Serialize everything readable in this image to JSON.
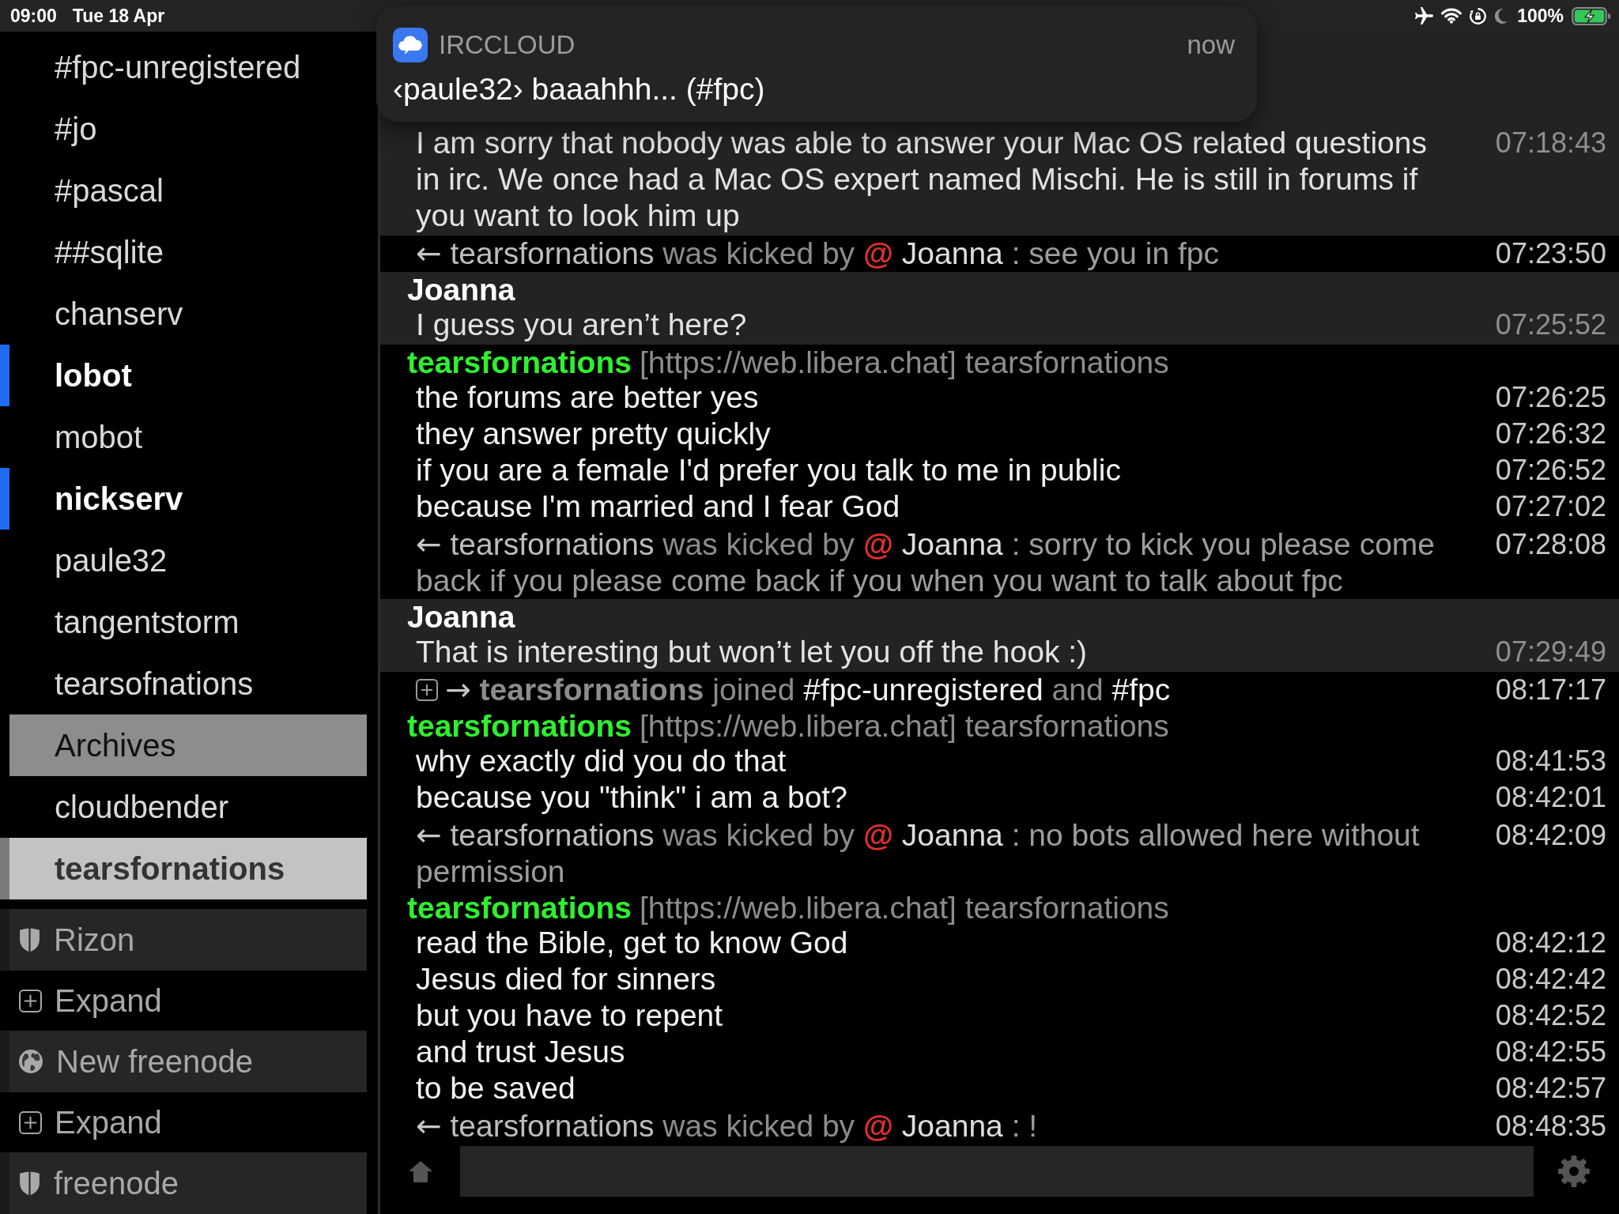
{
  "status_bar": {
    "time": "09:00",
    "date": "Tue 18 Apr",
    "battery": "100%"
  },
  "notification": {
    "app": "IRCCLOUD",
    "time": "now",
    "message": "‹paule32› baaahhh... (#fpc)"
  },
  "sidebar": {
    "items": [
      {
        "kind": "channel",
        "label": "#fpc-unregistered",
        "selected": false,
        "unread": false
      },
      {
        "kind": "channel",
        "label": "#jo",
        "selected": false,
        "unread": false
      },
      {
        "kind": "channel",
        "label": "#pascal",
        "selected": false,
        "unread": false
      },
      {
        "kind": "channel",
        "label": "##sqlite",
        "selected": false,
        "unread": false
      },
      {
        "kind": "channel",
        "label": "chanserv",
        "selected": false,
        "unread": false
      },
      {
        "kind": "channel",
        "label": "lobot",
        "selected": false,
        "unread": true
      },
      {
        "kind": "channel",
        "label": "mobot",
        "selected": false,
        "unread": false
      },
      {
        "kind": "channel",
        "label": "nickserv",
        "selected": false,
        "unread": true
      },
      {
        "kind": "channel",
        "label": "paule32",
        "selected": false,
        "unread": false
      },
      {
        "kind": "channel",
        "label": "tangentstorm",
        "selected": false,
        "unread": false
      },
      {
        "kind": "channel",
        "label": "tearsofnations",
        "selected": false,
        "unread": false
      },
      {
        "kind": "archives",
        "label": "Archives",
        "selected": false,
        "unread": false
      },
      {
        "kind": "channel",
        "label": "cloudbender",
        "selected": false,
        "unread": false
      },
      {
        "kind": "channel",
        "label": "tearsfornations",
        "selected": true,
        "unread": false
      },
      {
        "kind": "network",
        "label": "Rizon",
        "secure": true,
        "selected": false,
        "unread": false
      },
      {
        "kind": "expand",
        "label": "Expand",
        "selected": false,
        "unread": false
      },
      {
        "kind": "network",
        "label": "New freenode",
        "secure": false,
        "selected": false,
        "unread": false
      },
      {
        "kind": "expand",
        "label": "Expand",
        "selected": false,
        "unread": false
      },
      {
        "kind": "network",
        "label": "freenode",
        "secure": true,
        "selected": false,
        "unread": false
      }
    ]
  },
  "chat": {
    "entries": [
      {
        "kind": "message",
        "self": true,
        "lines": [
          {
            "text": "I am sorry that nobody was able to answer your Mac OS related questions in irc. We once had a Mac OS expert named Mischi. He is still in forums if you want to look him up",
            "time": "07:18:43"
          }
        ]
      },
      {
        "kind": "kick",
        "arrow": "←",
        "nick": "tearsfornations",
        "action": "was kicked by",
        "op": "@",
        "by": "Joanna",
        "reason": ": see you in fpc",
        "time": "07:23:50"
      },
      {
        "kind": "message",
        "self": true,
        "nick": "Joanna",
        "color": "#ffffff",
        "lines": [
          {
            "text": "I guess you aren’t here?",
            "time": "07:25:52"
          }
        ]
      },
      {
        "kind": "message",
        "self": false,
        "nick": "tearsfornations",
        "color": "#2ff02f",
        "host": "[https://web.libera.chat] tearsfornations",
        "lines": [
          {
            "text": "the forums are better yes",
            "time": "07:26:25"
          },
          {
            "text": "they answer pretty quickly",
            "time": "07:26:32"
          },
          {
            "text": "if you are a female I'd prefer you talk to me in public",
            "time": "07:26:52"
          },
          {
            "text": "because I'm married and I fear God",
            "time": "07:27:02"
          }
        ]
      },
      {
        "kind": "kick",
        "arrow": "←",
        "nick": "tearsfornations",
        "action": "was kicked by",
        "op": "@",
        "by": "Joanna",
        "reason": ": sorry to kick you please come back if you please come back if you when you want to talk about fpc",
        "time": "07:28:08"
      },
      {
        "kind": "message",
        "self": true,
        "nick": "Joanna",
        "color": "#ffffff",
        "lines": [
          {
            "text": "That is interesting but won’t let you off the hook :)",
            "time": "07:29:49"
          }
        ]
      },
      {
        "kind": "join",
        "arrow": "→",
        "nick": "tearsfornations",
        "action": "joined",
        "channels": [
          "#fpc-unregistered",
          "#fpc"
        ],
        "conjunction": "and",
        "time": "08:17:17"
      },
      {
        "kind": "message",
        "self": false,
        "nick": "tearsfornations",
        "color": "#2ff02f",
        "host": "[https://web.libera.chat] tearsfornations",
        "lines": [
          {
            "text": "why exactly did you do that",
            "time": "08:41:53"
          },
          {
            "text": "because you \"think\" i am a bot?",
            "time": "08:42:01"
          }
        ]
      },
      {
        "kind": "kick",
        "arrow": "←",
        "nick": "tearsfornations",
        "action": "was kicked by",
        "op": "@",
        "by": "Joanna",
        "reason": ": no bots allowed here without permission",
        "time": "08:42:09"
      },
      {
        "kind": "message",
        "self": false,
        "nick": "tearsfornations",
        "color": "#2ff02f",
        "host": "[https://web.libera.chat] tearsfornations",
        "lines": [
          {
            "text": "read the Bible, get to know God",
            "time": "08:42:12"
          },
          {
            "text": "Jesus died for sinners",
            "time": "08:42:42"
          },
          {
            "text": "but you have to repent",
            "time": "08:42:52"
          },
          {
            "text": "and trust Jesus",
            "time": "08:42:55"
          },
          {
            "text": "to be saved",
            "time": "08:42:57"
          }
        ]
      },
      {
        "kind": "kick",
        "arrow": "←",
        "nick": "tearsfornations",
        "action": "was kicked by",
        "op": "@",
        "by": "Joanna",
        "reason": ": !",
        "time": "08:48:35"
      }
    ]
  }
}
